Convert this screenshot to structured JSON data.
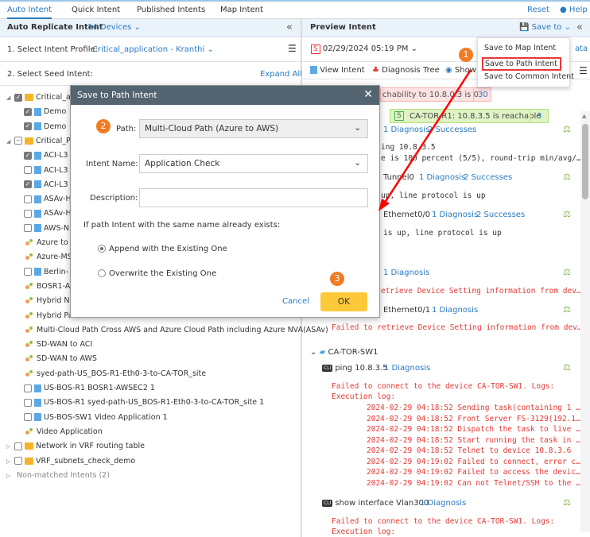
{
  "tabs": [
    "Auto Intent",
    "Quick Intent",
    "Published Intents",
    "Map Intent"
  ],
  "top_links": {
    "reset": "Reset",
    "help": "Help"
  },
  "left": {
    "header": "Auto Replicate Intent",
    "devices": "14 Devices",
    "profile_label": "1. Select Intent Profile:",
    "profile_value": "Critical_application - Kranthi",
    "seed_label": "2. Select Seed Intent:",
    "expand_all": "Expand All",
    "tree": [
      {
        "text": "Critical_ap",
        "kind": "folder",
        "level": 0,
        "check": "on",
        "open": true
      },
      {
        "text": "Demo",
        "kind": "intent",
        "level": 1,
        "check": "on"
      },
      {
        "text": "Demo",
        "kind": "intent",
        "level": 1,
        "check": "on"
      },
      {
        "text": "Critical_Pa",
        "kind": "folder",
        "level": 0,
        "check": "partial",
        "open": true
      },
      {
        "text": "ACI-L3",
        "kind": "intent",
        "level": 1,
        "check": "on"
      },
      {
        "text": "ACI-L3",
        "kind": "intent",
        "level": 1,
        "check": "off"
      },
      {
        "text": "ACI-L3",
        "kind": "intent",
        "level": 1,
        "check": "on"
      },
      {
        "text": "ASAv-H",
        "kind": "intent",
        "level": 1,
        "check": "off"
      },
      {
        "text": "ASAv-H",
        "kind": "intent",
        "level": 1,
        "check": "off"
      },
      {
        "text": "AWS-N",
        "kind": "intent",
        "level": 1,
        "check": "off"
      },
      {
        "text": "Azure to C",
        "kind": "path",
        "level": 1
      },
      {
        "text": "Azure-MSI",
        "kind": "path",
        "level": 1
      },
      {
        "text": "Berlin-",
        "kind": "intent",
        "level": 1,
        "check": "off"
      },
      {
        "text": "BOSR1-AW",
        "kind": "path",
        "level": 1
      },
      {
        "text": "Hybrid Ne",
        "kind": "path",
        "level": 1
      },
      {
        "text": "Hybrid Pa",
        "kind": "path",
        "level": 1
      },
      {
        "text": "Multi-Cloud Path Cross AWS and Azure Cloud Path including Azure NVA(ASAv)",
        "kind": "path",
        "level": 1
      },
      {
        "text": "SD-WAN to ACI",
        "kind": "path",
        "level": 1
      },
      {
        "text": "SD-WAN to AWS",
        "kind": "path",
        "level": 1
      },
      {
        "text": "syed-path-US_BOS-R1-Eth0-3-to-CA-TOR_site",
        "kind": "path",
        "level": 1
      },
      {
        "text": "US-BOS-R1 BOSR1-AWSEC2 1",
        "kind": "intent",
        "level": 1,
        "check": "off"
      },
      {
        "text": "US-BOS-R1 syed-path-US_BOS-R1-Eth0-3-to-CA-TOR_site 1",
        "kind": "intent",
        "level": 1,
        "check": "off"
      },
      {
        "text": "US-BOS-SW1 Video Application 1",
        "kind": "intent",
        "level": 1,
        "check": "off"
      },
      {
        "text": "Video Application",
        "kind": "path",
        "level": 1
      },
      {
        "text": "Network in VRF routing table",
        "kind": "folder",
        "level": 0,
        "check": "off",
        "open": false
      },
      {
        "text": "VRF_subnets_check_demo",
        "kind": "folder",
        "level": 0,
        "check": "off",
        "open": false
      },
      {
        "text": "Non-matched Intents (2)",
        "kind": "group",
        "level": 0,
        "open": false
      }
    ]
  },
  "right": {
    "header": "Preview Intent",
    "save_to": "Save to",
    "date": "02/29/2024 05:19 PM",
    "data_link": "ata",
    "toolbar": {
      "view_intent": "View Intent",
      "diagnosis_tree": "Diagnosis Tree",
      "show": "Show"
    },
    "menu": [
      "Save to Map Intent",
      "Save to Path Intent",
      "Save to Common Intent"
    ],
    "red_bar": {
      "text": "chability to 10.8.0.3 is 0",
      "count": "30"
    },
    "green_bar": {
      "icon": "S",
      "text": "CA-TOR-R1: 10.8.3.5 is reachable",
      "count": "3"
    },
    "lines": {
      "l1_diag": "1 Diagnosis",
      "l1_succ": "2 Successes",
      "ping_cmd": "ing 10.8.3.5",
      "ping_out": "e is 100 percent (5/5), round-trip min/avg/…",
      "tun": "Tunnel0",
      "tun_diag": "1 Diagnosis",
      "tun_succ": "2 Successes",
      "tun_out": "up, line protocol is up",
      "eth0": "Ethernet0/0",
      "eth0_diag": "1 Diagnosis",
      "eth0_succ": "2 Successes",
      "eth0_out": "is up, line protocol is up",
      "d4": "1 Diagnosis",
      "err1": "etrieve Device Setting information from dev…",
      "eth1": "Ethernet0/1",
      "eth1_diag": "1 Diagnosis",
      "err2": "Failed to retrieve Device Setting information from dev…"
    },
    "device": "CA-TOR-SW1",
    "cmd1": {
      "label": "ping 10.8.3.5",
      "diag": "1 Diagnosis",
      "err": "Failed to connect to the device CA-TOR-SW1. Logs:",
      "exec": "Execution log:",
      "logs": [
        "2024-02-29 04:18:52 Sending task(containing 1 …",
        "2024-02-29 04:18:52 Front Server FS-3129(192.1…",
        "2024-02-29 04:18:52 Dispatch the task to live …",
        "2024-02-29 04:18:52 Start running the task in …",
        "2024-02-29 04:18:52 Telnet to device 10.8.3.6",
        "2024-02-29 04:19:02 Failed to connect, error c…",
        "2024-02-29 04:19:02 Failed to access the devic…",
        "2024-02-29 04:19:02 Can not Telnet/SSH to the …"
      ]
    },
    "cmd2": {
      "label": "show interface Vlan300",
      "diag": "1 Diagnosis",
      "err": "Failed to connect to the device CA-TOR-SW1. Logs:",
      "exec": "Execution log:"
    }
  },
  "modal": {
    "title": "Save to Path Intent",
    "path_label": "Path:",
    "path_value": "Multi-Cloud Path (Azure to AWS)",
    "name_label": "Intent Name:",
    "name_value": "Application Check",
    "desc_label": "Description:",
    "desc_value": "",
    "exists_label": "If path Intent with the same name already exists:",
    "opt_append": "Append with the Existing One",
    "opt_overwrite": "Overwrite the Existing One",
    "cancel": "Cancel",
    "ok": "OK"
  },
  "badges": [
    "1",
    "2",
    "3"
  ],
  "colors": {
    "accent": "#2a7ac0",
    "badge": "#f07c24",
    "ok": "#fcc93b",
    "modal_header": "#546470"
  }
}
